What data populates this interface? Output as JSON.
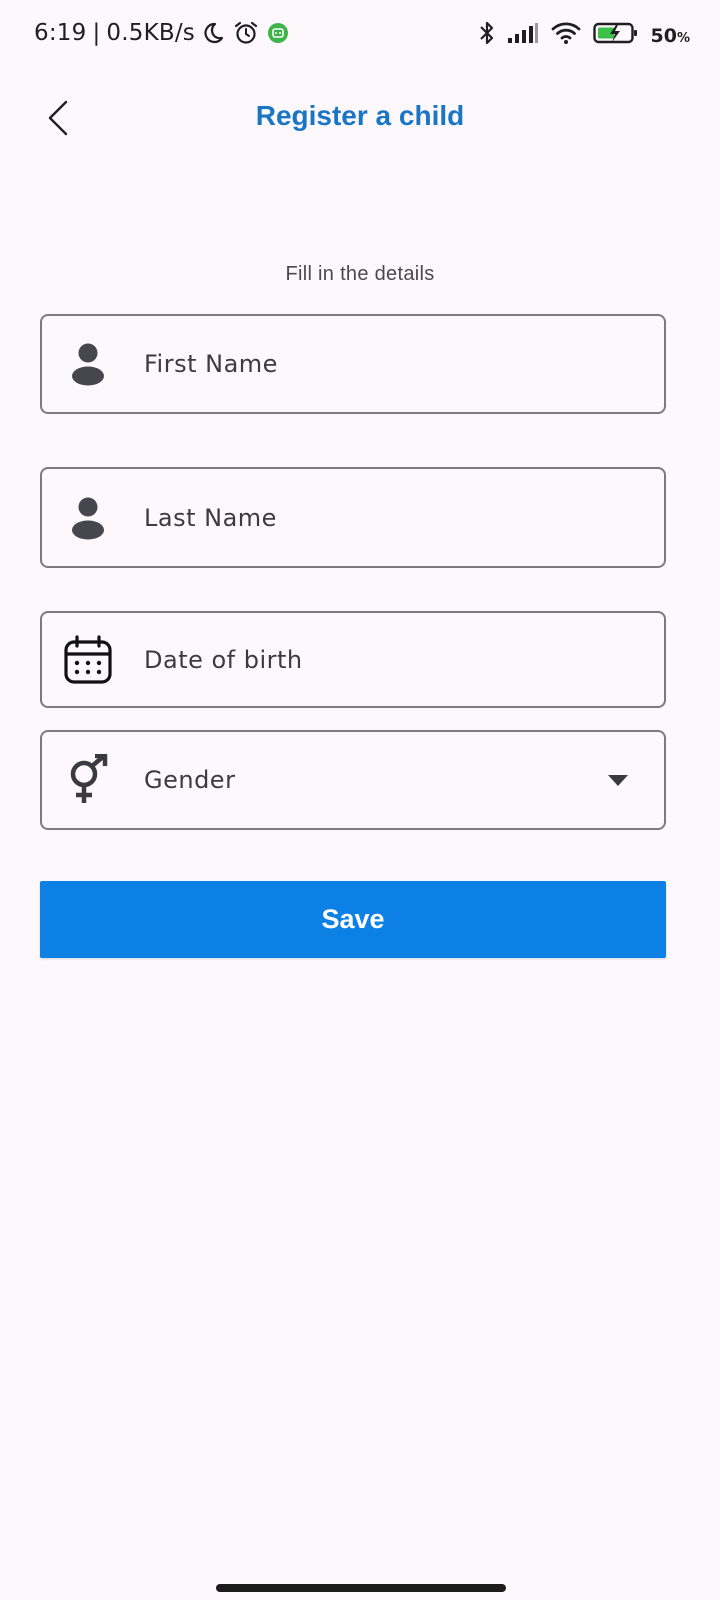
{
  "status_bar": {
    "time": "6:19",
    "separator": "|",
    "network_speed": "0.5KB/s",
    "battery_percent": "50",
    "battery_unit": "%",
    "icons_left": [
      "moon-icon",
      "alarm-icon",
      "app-notification-icon"
    ],
    "icons_right": [
      "bluetooth-icon",
      "signal-icon",
      "wifi-icon",
      "battery-charging-icon"
    ]
  },
  "header": {
    "title": "Register a child",
    "back_icon": "chevron-left-icon"
  },
  "form": {
    "subtitle": "Fill in the details",
    "first_name": {
      "placeholder": "First Name",
      "icon": "person-icon"
    },
    "last_name": {
      "placeholder": "Last Name",
      "icon": "person-icon"
    },
    "date_of_birth": {
      "placeholder": "Date of birth",
      "icon": "calendar-icon"
    },
    "gender": {
      "placeholder": "Gender",
      "icon": "gender-icon",
      "dropdown_icon": "dropdown-arrow-icon"
    },
    "save_label": "Save"
  },
  "colors": {
    "accent": "#1a76c4",
    "button": "#0d80e6",
    "background": "#fdf8fb",
    "border": "#7a7a80"
  }
}
